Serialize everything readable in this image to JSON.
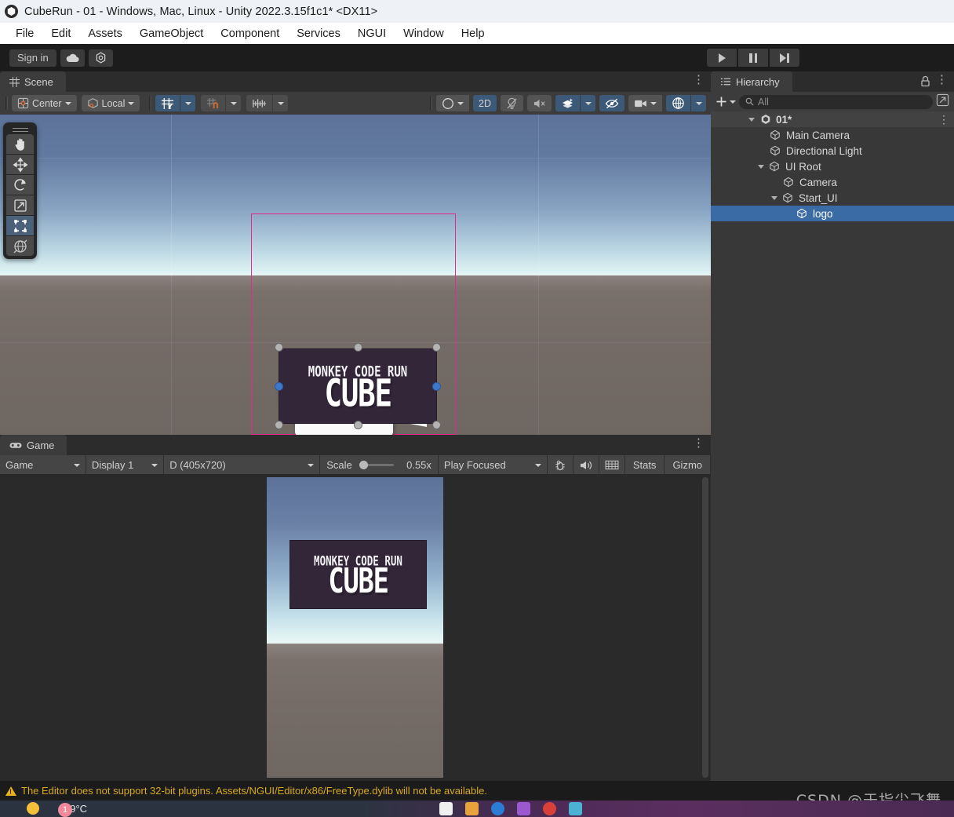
{
  "window": {
    "title": "CubeRun - 01 - Windows, Mac, Linux - Unity 2022.3.15f1c1* <DX11>",
    "logo_icon": "unity-logo-icon"
  },
  "menubar": {
    "items": [
      "File",
      "Edit",
      "Assets",
      "GameObject",
      "Component",
      "Services",
      "NGUI",
      "Window",
      "Help"
    ]
  },
  "toolbar": {
    "sign_in": "Sign in",
    "cloud_icon": "cloud-icon",
    "settings_icon": "gear-icon",
    "play_icon": "play-icon",
    "pause_icon": "pause-icon",
    "step_icon": "step-icon"
  },
  "scene": {
    "tab_label": "Scene",
    "tab_icon": "grid-icon",
    "menu_icon": "kebab-menu-icon",
    "pivot_mode": "Center",
    "pivot_icon": "pivot-center-icon",
    "handle_space": "Local",
    "handle_icon": "local-space-icon",
    "grid_axis_icon": "grid-axis-y-icon",
    "snap_icon": "grid-snap-magnet-icon",
    "grid_size_icon": "grid-ruler-icon",
    "shading_icon": "shaded-sphere-icon",
    "mode_2d": "2D",
    "lighting_icon": "lighting-off-icon",
    "audio_icon": "audio-off-icon",
    "fx_icon": "effects-icon",
    "hidden_icon": "visibility-off-icon",
    "camera_icon": "scene-camera-icon",
    "gizmos_icon": "gizmos-globe-icon",
    "tools": [
      {
        "name": "hand-tool",
        "icon": "hand-icon",
        "selected": false
      },
      {
        "name": "move-tool",
        "icon": "move-arrows-icon",
        "selected": false
      },
      {
        "name": "rotate-tool",
        "icon": "rotate-icon",
        "selected": false
      },
      {
        "name": "scale-tool",
        "icon": "scale-icon",
        "selected": false
      },
      {
        "name": "rect-tool",
        "icon": "rect-transform-icon",
        "selected": true
      },
      {
        "name": "transform-tool",
        "icon": "transform-globe-icon",
        "selected": false
      }
    ],
    "logo_line1": "MONKEY CODE RUN",
    "logo_line2": "CUBE",
    "selection_color": "#e62a8b",
    "handle_color": "#b3b3b3",
    "handle_active_color": "#3d79c9",
    "sky_top_color": "#5d7299",
    "horizon_color": "#dbf0f1",
    "ground_color": "#746b66"
  },
  "game": {
    "tab_label": "Game",
    "tab_icon": "gamepad-icon",
    "menu_icon": "kebab-menu-icon",
    "view_mode": "Game",
    "display": "Display 1",
    "resolution": "D (405x720)",
    "scale_label": "Scale",
    "scale_value": "0.55x",
    "scale_percent": 18,
    "play_mode": "Play Focused",
    "bug_icon": "debug-bug-icon",
    "mute_icon": "audio-speaker-icon",
    "aspect_icon": "low-resolution-icon",
    "stats_label": "Stats",
    "gizmos_label": "Gizmo",
    "logo_line1": "MONKEY CODE RUN",
    "logo_line2": "CUBE"
  },
  "hierarchy": {
    "tab_label": "Hierarchy",
    "tab_icon": "hierarchy-list-icon",
    "lock_icon": "lock-icon",
    "menu_icon": "kebab-menu-icon",
    "add_label": "+",
    "add_icon": "plus-icon",
    "search_placeholder": "All",
    "search_icon": "search-icon",
    "search_value": "",
    "expand_icon": "expand-window-icon",
    "selected_color": "#3a6ba5",
    "rows": [
      {
        "label": "01*",
        "depth": 0,
        "icon": "unity-scene-icon",
        "expanded": true,
        "selected": false,
        "has_menu": true
      },
      {
        "label": "Main Camera",
        "depth": 1,
        "icon": "cube-icon",
        "expanded": null,
        "selected": false,
        "has_menu": false
      },
      {
        "label": "Directional Light",
        "depth": 1,
        "icon": "cube-icon",
        "expanded": null,
        "selected": false,
        "has_menu": false
      },
      {
        "label": "UI Root",
        "depth": 1,
        "icon": "cube-icon",
        "expanded": true,
        "selected": false,
        "has_menu": false
      },
      {
        "label": "Camera",
        "depth": 2,
        "icon": "cube-icon",
        "expanded": null,
        "selected": false,
        "has_menu": false
      },
      {
        "label": "Start_UI",
        "depth": 2,
        "icon": "cube-icon",
        "expanded": true,
        "selected": false,
        "has_menu": false
      },
      {
        "label": "logo",
        "depth": 3,
        "icon": "cube-icon",
        "expanded": null,
        "selected": true,
        "has_menu": false
      }
    ]
  },
  "status": {
    "warning_icon": "warning-triangle-icon",
    "message": "The Editor does not support 32-bit plugins. Assets/NGUI/Editor/x86/FreeType.dylib will not be available.",
    "color": "#d9a920"
  },
  "watermark": {
    "text": "CSDN @于指尖飞舞"
  },
  "taskbar": {
    "temperature": "19°C",
    "notification_count": "1",
    "weather_icon": "sun-cloud-icon"
  }
}
